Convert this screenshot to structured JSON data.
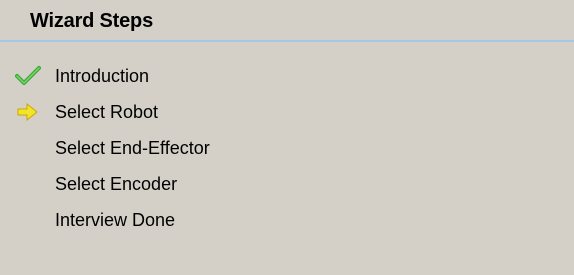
{
  "panel": {
    "title": "Wizard Steps"
  },
  "steps": [
    {
      "label": "Introduction",
      "state": "completed",
      "icon": "checkmark-icon"
    },
    {
      "label": "Select Robot",
      "state": "current",
      "icon": "arrow-right-icon"
    },
    {
      "label": "Select End-Effector",
      "state": "pending",
      "icon": ""
    },
    {
      "label": "Select Encoder",
      "state": "pending",
      "icon": ""
    },
    {
      "label": "Interview Done",
      "state": "pending",
      "icon": ""
    }
  ],
  "colors": {
    "background": "#d4d0c8",
    "header_divider": "#a6c8e6",
    "check": "#3aa832",
    "arrow": "#f5e32a"
  }
}
